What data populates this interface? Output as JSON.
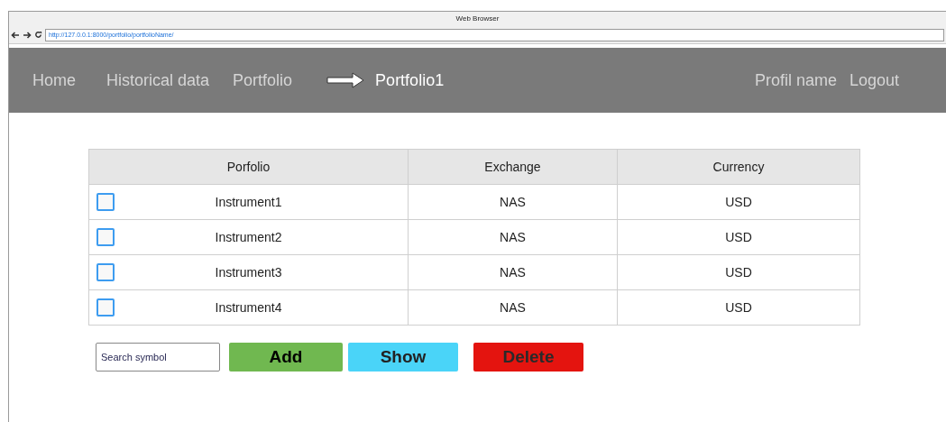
{
  "window": {
    "title": "Web Browser"
  },
  "address_bar": {
    "url": "http://127.0.0.1:8000/portfolio/portfolioName/"
  },
  "nav": {
    "items": [
      {
        "label": "Home",
        "selected": false
      },
      {
        "label": "Historical data",
        "selected": false
      },
      {
        "label": "Portfolio",
        "selected": false
      },
      {
        "label": "Portfolio1",
        "selected": true
      }
    ],
    "right_items": [
      {
        "label": "Profil name"
      },
      {
        "label": "Logout"
      }
    ]
  },
  "table": {
    "columns": [
      "Porfolio",
      "Exchange",
      "Currency"
    ],
    "rows": [
      {
        "checked": false,
        "cells": [
          "Instrument1",
          "NAS",
          "USD"
        ]
      },
      {
        "checked": false,
        "cells": [
          "Instrument2",
          "NAS",
          "USD"
        ]
      },
      {
        "checked": false,
        "cells": [
          "Instrument3",
          "NAS",
          "USD"
        ]
      },
      {
        "checked": false,
        "cells": [
          "Instrument4",
          "NAS",
          "USD"
        ]
      }
    ]
  },
  "search": {
    "placeholder": "Search symbol"
  },
  "buttons": [
    {
      "label": "Add",
      "kind": "add"
    },
    {
      "label": "Show",
      "kind": "show"
    },
    {
      "label": "Delete",
      "kind": "delete"
    }
  ]
}
